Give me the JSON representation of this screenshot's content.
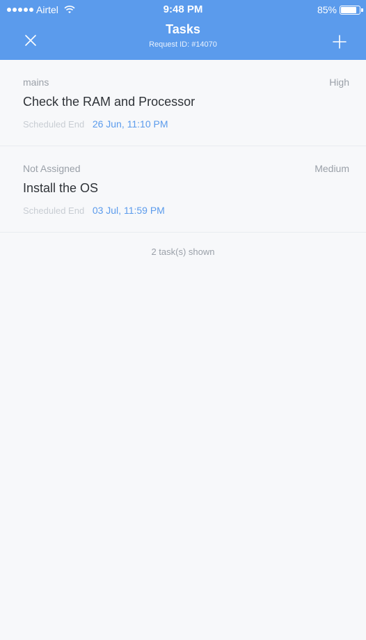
{
  "status_bar": {
    "carrier": "Airtel",
    "time": "9:48 PM",
    "battery": "85%",
    "battery_level": 0.85
  },
  "header": {
    "title": "Tasks",
    "subtitle": "Request ID: #14070",
    "background_color": "#5b9bec"
  },
  "tasks": [
    {
      "assignee": "mains",
      "priority": "High",
      "title": "Check the RAM and Processor",
      "scheduled_label": "Scheduled End",
      "scheduled_value": "26 Jun, 11:10 PM"
    },
    {
      "assignee": "Not Assigned",
      "priority": "Medium",
      "title": "Install the OS",
      "scheduled_label": "Scheduled End",
      "scheduled_value": "03 Jul, 11:59 PM"
    }
  ],
  "footer": {
    "count_text": "2 task(s) shown"
  },
  "icons": {
    "close": "close-icon",
    "add": "plus-icon",
    "wifi": "wifi-icon",
    "battery": "battery-icon"
  }
}
